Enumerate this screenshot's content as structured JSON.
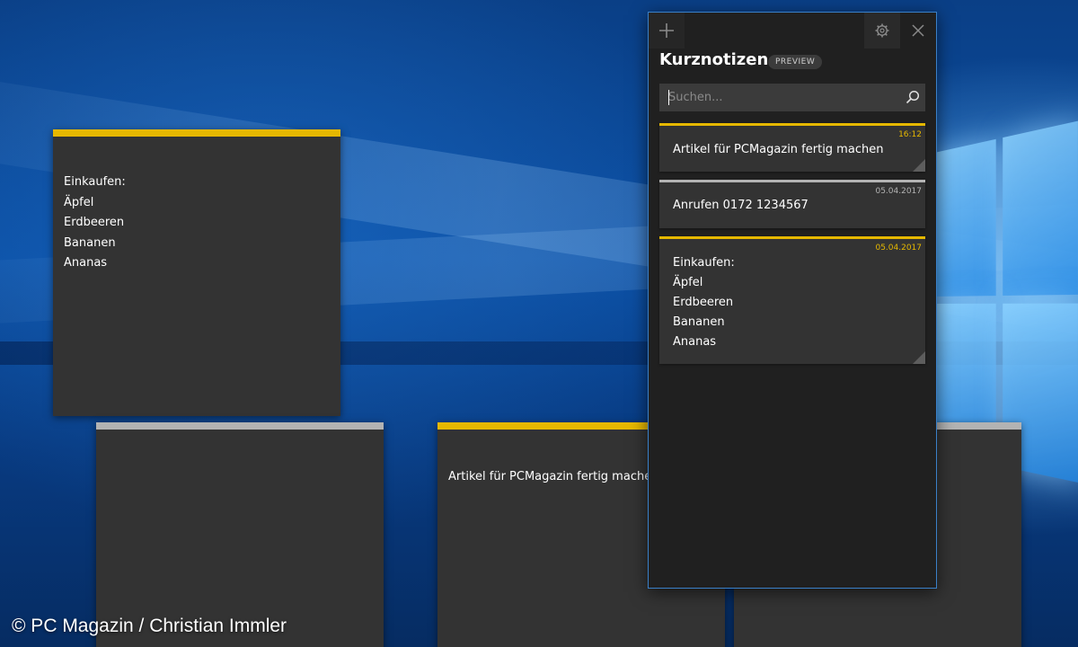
{
  "colors": {
    "accent_yellow": "#e6b800",
    "accent_gray": "#b3b3b3",
    "panel_bg": "#202020",
    "note_bg": "#333333",
    "panel_border": "#3a80c8"
  },
  "desktop_notes": [
    {
      "color": "yellow",
      "lines": [
        "Einkaufen:",
        "Äpfel",
        "Erdbeeren",
        "Bananen",
        "Ananas"
      ]
    },
    {
      "color": "gray",
      "lines": []
    },
    {
      "color": "yellow",
      "lines": [
        "Artikel für PCMagazin fertig machen"
      ]
    },
    {
      "color": "gray",
      "lines": []
    }
  ],
  "panel": {
    "title": "Kurznotizen",
    "badge": "PREVIEW",
    "buttons": {
      "add_icon": "plus-icon",
      "settings_icon": "gear-icon",
      "close_icon": "close-icon"
    },
    "search": {
      "placeholder": "Suchen...",
      "value": "",
      "icon": "search-icon"
    },
    "notes": [
      {
        "color": "yellow",
        "timestamp": "16:12",
        "lines": [
          "Artikel für PCMagazin fertig machen"
        ]
      },
      {
        "color": "gray",
        "timestamp": "05.04.2017",
        "lines": [
          "Anrufen 0172 1234567"
        ]
      },
      {
        "color": "yellow",
        "timestamp": "05.04.2017",
        "lines": [
          "Einkaufen:",
          "Äpfel",
          "Erdbeeren",
          "Bananen",
          "Ananas"
        ]
      }
    ]
  },
  "watermark": "© PC Magazin / Christian Immler"
}
